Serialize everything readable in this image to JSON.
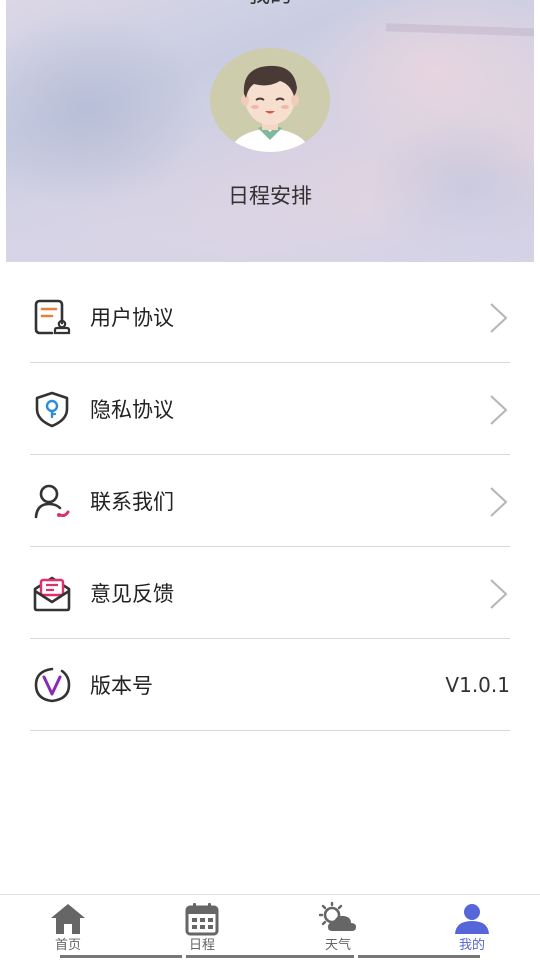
{
  "header": {
    "title": "我的",
    "username": "日程安排"
  },
  "menu": {
    "items": [
      {
        "label": "用户协议",
        "icon": "user-agreement-icon",
        "has_arrow": true
      },
      {
        "label": "隐私协议",
        "icon": "privacy-shield-icon",
        "has_arrow": true
      },
      {
        "label": "联系我们",
        "icon": "contact-person-icon",
        "has_arrow": true
      },
      {
        "label": "意见反馈",
        "icon": "feedback-mail-icon",
        "has_arrow": true
      },
      {
        "label": "版本号",
        "icon": "version-v-icon",
        "value": "V1.0.1"
      }
    ]
  },
  "tabbar": {
    "tabs": [
      {
        "label": "首页",
        "icon": "home-icon",
        "active": false
      },
      {
        "label": "日程",
        "icon": "calendar-icon",
        "active": false
      },
      {
        "label": "天气",
        "icon": "weather-icon",
        "active": false
      },
      {
        "label": "我的",
        "icon": "profile-icon",
        "active": true
      }
    ]
  },
  "colors": {
    "accent": "#5566d8",
    "icon_dark": "#333333",
    "icon_orange": "#e8803a",
    "icon_blue": "#2a8fd8",
    "icon_pink": "#e0306a",
    "icon_purple": "#8a2bb8"
  }
}
